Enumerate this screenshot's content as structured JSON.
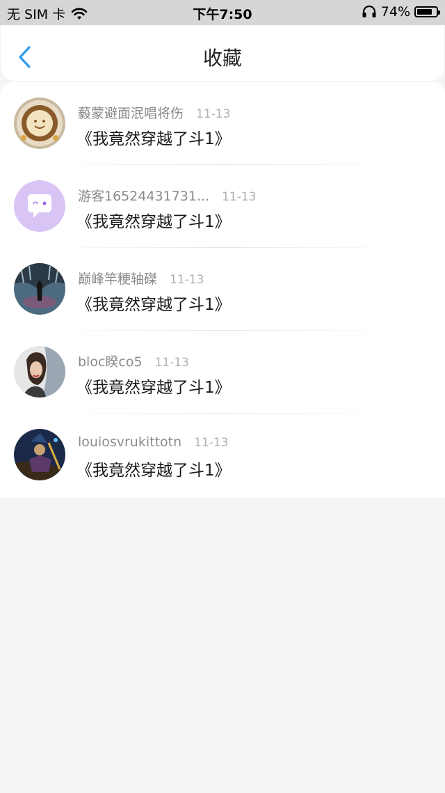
{
  "status_bar": {
    "carrier": "无 SIM 卡",
    "time": "下午7:50",
    "battery": "74%"
  },
  "nav": {
    "title": "收藏"
  },
  "favorites": [
    {
      "username": "藙蒙避面泯唱将伤",
      "date": "11-13",
      "book": "《我竟然穿越了斗1》",
      "avatar_icon": "latte-art-avatar"
    },
    {
      "username": "游客16524431731...",
      "date": "11-13",
      "book": "《我竟然穿越了斗1》",
      "avatar_icon": "chat-bubble-avatar"
    },
    {
      "username": "巅峰竿粳轴磔",
      "date": "11-13",
      "book": "《我竟然穿越了斗1》",
      "avatar_icon": "dark-art-avatar"
    },
    {
      "username": "bloc睽co5",
      "date": "11-13",
      "book": "《我竟然穿越了斗1》",
      "avatar_icon": "woman-photo-avatar"
    },
    {
      "username": "louiosvrukittotn",
      "date": "11-13",
      "book": "《我竟然穿越了斗1》",
      "avatar_icon": "game-character-avatar"
    }
  ]
}
